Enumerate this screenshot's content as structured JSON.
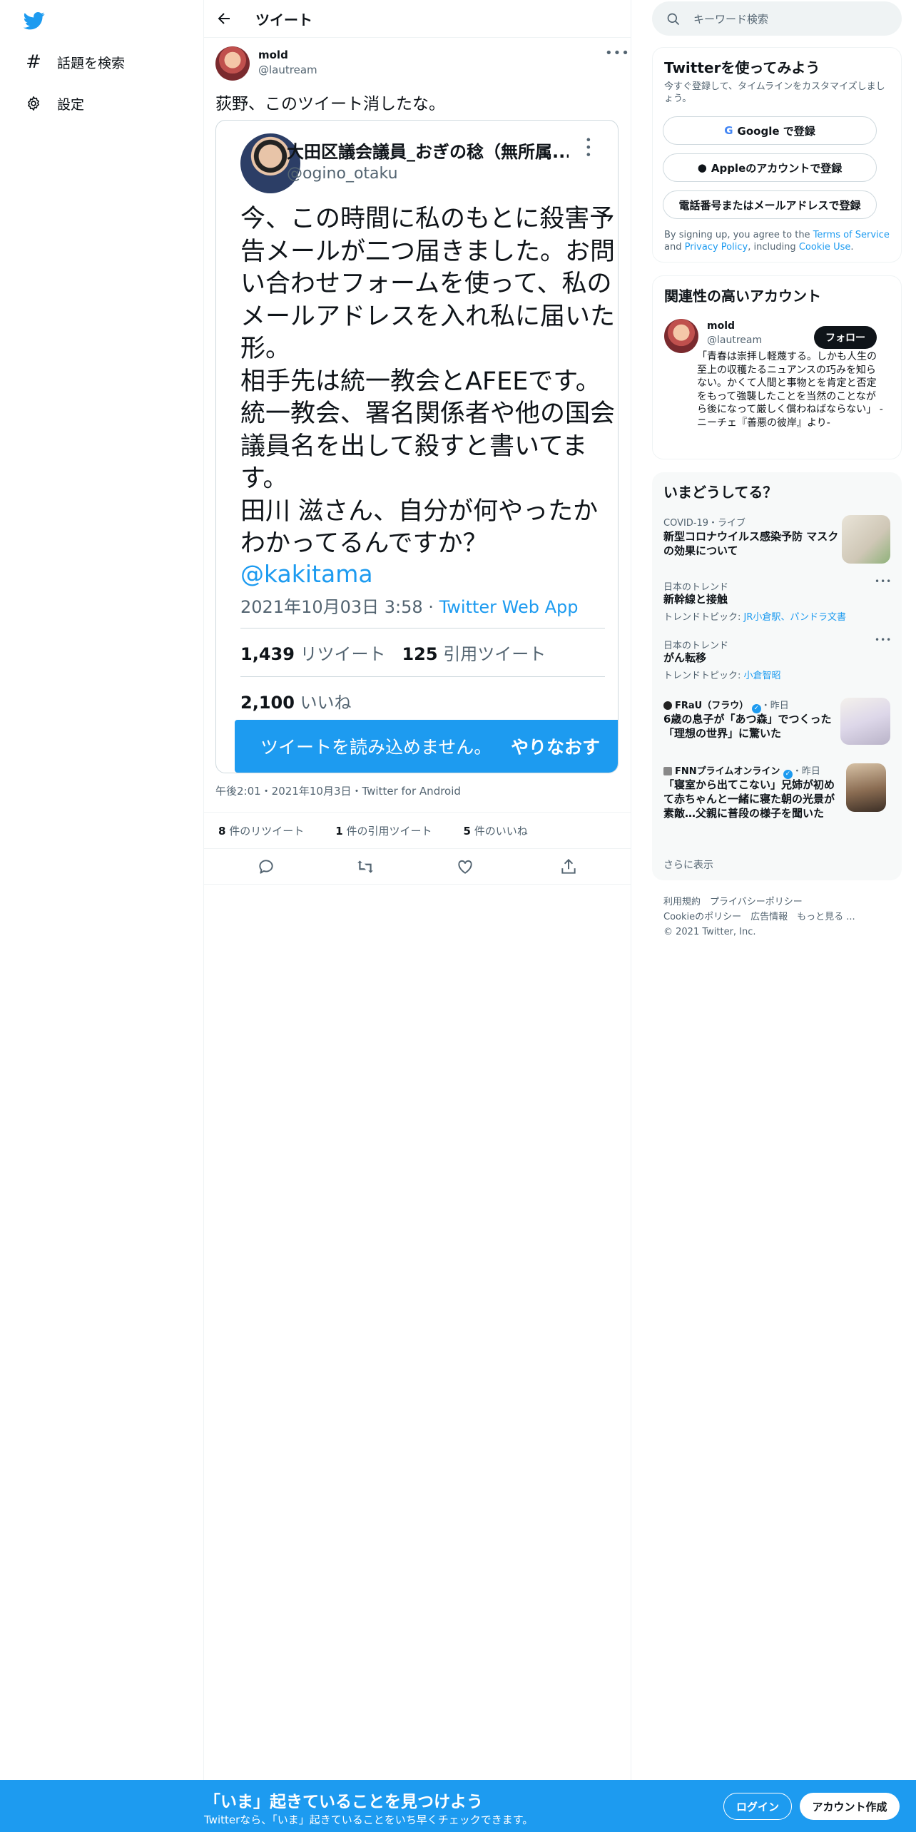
{
  "sidebar": {
    "explore_label": "話題を検索",
    "settings_label": "設定"
  },
  "header": {
    "title": "ツイート"
  },
  "tweet": {
    "name": "mold",
    "handle": "@lautream",
    "text": "荻野、このツイート消したな。",
    "meta": "午後2:01・2021年10月3日・Twitter for Android",
    "retweets_count": "8",
    "retweets_label": "件のリツイート",
    "quotes_count": "1",
    "quotes_label": "件の引用ツイート",
    "likes_count": "5",
    "likes_label": "件のいいね"
  },
  "embed": {
    "name": "大田区議会議員_おぎの稔（無所属...",
    "handle": "@ogino_otaku",
    "body_lines": [
      "今、この時間に私のもとに殺害予告メールが二つ届きました。お問い合わせフォームを使って、私のメールアドレスを入れ私に届いた形。",
      "相手先は統一教会とAFEEです。統一教会、署名関係者や他の国会議員名を出して殺すと書いてます。",
      "田川 滋さん、自分が何やったかわかってるんですか？"
    ],
    "mention": "@kakitama",
    "date": "2021年10月03日 3:58 · ",
    "source": "Twitter Web App",
    "retweets_count": "1,439",
    "retweets_label": "リツイート",
    "quotes_count": "125",
    "quotes_label": "引用ツイート",
    "likes_count": "2,100",
    "likes_label": "いいね",
    "error_text": "ツイートを読み込めません。",
    "retry_label": "やりなおす"
  },
  "search": {
    "placeholder": "キーワード検索"
  },
  "signup_card": {
    "title": "Twitterを使ってみよう",
    "subtitle": "今すぐ登録して、タイムラインをカスタマイズしましょう。",
    "google_label": "Google で登録",
    "apple_label": "Appleのアカウントで登録",
    "phone_label": "電話番号またはメールアドレスで登録",
    "terms_prefix": "By signing up, you agree to the ",
    "terms_link": "Terms of Service",
    "terms_and": " and ",
    "privacy_link": "Privacy Policy",
    "terms_mid": ", including ",
    "cookie_link": "Cookie Use",
    "terms_end": "."
  },
  "related": {
    "title": "関連性の高いアカウント",
    "name": "mold",
    "handle": "@lautream",
    "follow_label": "フォロー",
    "bio": "「青春は崇拝し軽蔑する。しかも人生の至上の収穫たるニュアンスの巧みを知らない。かくて人間と事物とを肯定と否定をもって強襲したことを当然のことながら後になって厳しく償わねばならない」 -ニーチェ『善悪の彼岸』より-"
  },
  "trends": {
    "title": "いまどうしてる？",
    "items": [
      {
        "category": "COVID-19・ライブ",
        "title": "新型コロナウイルス感染予防 マスクの効果について"
      },
      {
        "category": "日本のトレンド",
        "title": "新幹線と接触",
        "topic_prefix": "トレンドトピック: ",
        "topic": "JR小倉駅、パンドラ文書"
      },
      {
        "category": "日本のトレンド",
        "title": "がん転移",
        "topic_prefix": "トレンドトピック: ",
        "topic": "小倉智昭"
      },
      {
        "source": "FRaU（フラウ）",
        "time": "・昨日",
        "title": "6歳の息子が「あつ森」でつくった「理想の世界」に驚いた"
      },
      {
        "source": "FNNプライムオンライン",
        "time": "・昨日",
        "title": "「寝室から出てこない」兄姉が初めて赤ちゃんと一緒に寝た朝の光景が素敵…父親に普段の様子を聞いた"
      }
    ],
    "show_more": "さらに表示"
  },
  "footer": {
    "line1": "利用規約　プライバシーポリシー",
    "line2": "Cookieのポリシー　広告情報　もっと見る ...",
    "line3": "© 2021 Twitter, Inc."
  },
  "bottom_bar": {
    "title": "「いま」起きていることを見つけよう",
    "subtitle": "Twitterなら、「いま」起きていることをいち早くチェックできます。",
    "login_label": "ログイン",
    "signup_label": "アカウント作成"
  },
  "colors": {
    "accent": "#1d9bf0",
    "text": "#0f1419",
    "muted": "#536471",
    "verified": "#1d9bf0"
  },
  "icons": [
    "twitter-logo-icon",
    "hashtag-icon",
    "gear-icon",
    "back-arrow-icon",
    "more-icon",
    "reply-icon",
    "retweet-icon",
    "like-icon",
    "share-icon",
    "search-icon",
    "google-icon",
    "apple-icon",
    "verified-icon"
  ]
}
